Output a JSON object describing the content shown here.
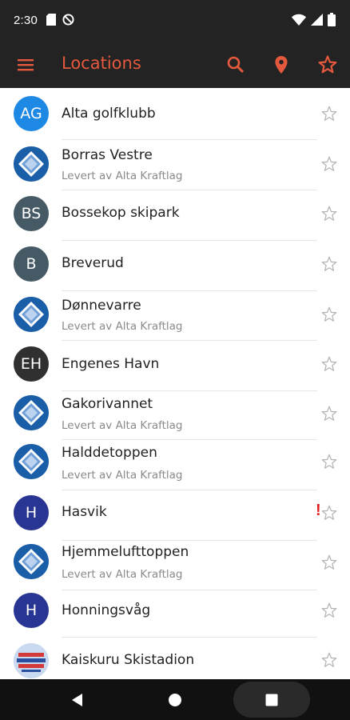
{
  "status_bar": {
    "time": "2:30",
    "left_icons": [
      "sd-card-icon",
      "no-disturb-icon"
    ],
    "right_icons": [
      "wifi-icon",
      "signal-icon",
      "battery-icon"
    ]
  },
  "app_bar": {
    "title": "Locations",
    "actions": [
      "search-icon",
      "location-pin-icon",
      "star-outline-icon"
    ],
    "accent_color": "#e4593e",
    "background_color": "#232323"
  },
  "locations": [
    {
      "name": "Alta golfklubb",
      "initials": "AG",
      "avatar_color": "#1e88e5",
      "subtitle": ""
    },
    {
      "name": "Borras Vestre",
      "initials": "",
      "avatar_type": "logo",
      "subtitle": "Levert av Alta Kraftlag"
    },
    {
      "name": "Bossekop skipark",
      "initials": "BS",
      "avatar_color": "#455a64",
      "subtitle": ""
    },
    {
      "name": "Breverud",
      "initials": "B",
      "avatar_color": "#455a64",
      "subtitle": ""
    },
    {
      "name": "Dønnevarre",
      "initials": "",
      "avatar_type": "logo",
      "subtitle": "Levert av Alta Kraftlag"
    },
    {
      "name": "Engenes Havn",
      "initials": "EH",
      "avatar_color": "#303030",
      "subtitle": ""
    },
    {
      "name": "Gakorivannet",
      "initials": "",
      "avatar_type": "logo",
      "subtitle": "Levert av Alta Kraftlag"
    },
    {
      "name": "Halddetoppen",
      "initials": "",
      "avatar_type": "logo",
      "subtitle": "Levert av Alta Kraftlag"
    },
    {
      "name": "Hasvik",
      "initials": "H",
      "avatar_color": "#283593",
      "subtitle": "",
      "alert": "!"
    },
    {
      "name": "Hjemmelufttoppen",
      "initials": "",
      "avatar_type": "logo",
      "subtitle": "Levert av Alta Kraftlag"
    },
    {
      "name": "Honningsvåg",
      "initials": "H",
      "avatar_color": "#283593",
      "subtitle": ""
    },
    {
      "name": "Kaiskuru Skistadion",
      "initials": "",
      "avatar_type": "poster",
      "subtitle": ""
    }
  ],
  "nav_bar": {
    "buttons": [
      "back-icon",
      "home-icon",
      "recents-icon"
    ]
  }
}
